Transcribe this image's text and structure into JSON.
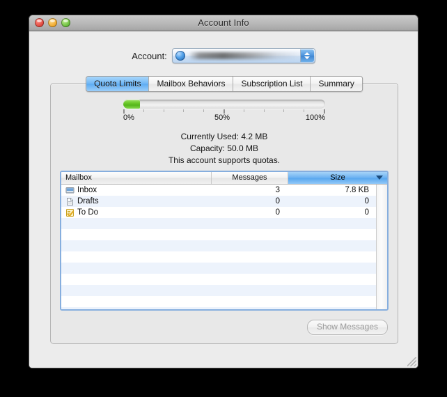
{
  "window": {
    "title": "Account Info",
    "traffic_lights": [
      "close-button",
      "minimize-button",
      "zoom-button"
    ]
  },
  "account": {
    "label": "Account:",
    "selected_value": "",
    "icon": "globe-icon",
    "redacted": true
  },
  "tabs": [
    {
      "label": "Quota Limits",
      "selected": true
    },
    {
      "label": "Mailbox Behaviors",
      "selected": false
    },
    {
      "label": "Subscription List",
      "selected": false
    },
    {
      "label": "Summary",
      "selected": false
    }
  ],
  "quota": {
    "percent_used": 8.4,
    "fill_color": "#6fcb2d",
    "axis_labels": [
      {
        "text": "0%",
        "pos": 0
      },
      {
        "text": "50%",
        "pos": 50
      },
      {
        "text": "100%",
        "pos": 100
      }
    ],
    "stats": [
      {
        "key": "Currently Used:",
        "value": "4.2 MB"
      },
      {
        "key": "Capacity:",
        "value": "50.0 MB"
      }
    ],
    "note": "This account supports quotas."
  },
  "table": {
    "columns": [
      {
        "label": "Mailbox",
        "sorted": false,
        "sort_dir": ""
      },
      {
        "label": "Messages",
        "sorted": false,
        "sort_dir": ""
      },
      {
        "label": "Size",
        "sorted": true,
        "sort_dir": "descending"
      }
    ],
    "rows": [
      {
        "icon": "inbox-icon",
        "mailbox": "Inbox",
        "messages": "3",
        "size": "7.8 KB"
      },
      {
        "icon": "drafts-icon",
        "mailbox": "Drafts",
        "messages": "0",
        "size": "0"
      },
      {
        "icon": "todo-icon",
        "mailbox": "To Do",
        "messages": "0",
        "size": "0"
      }
    ],
    "empty_row_count": 13
  },
  "footer": {
    "show_messages_label": "Show Messages",
    "show_messages_enabled": false
  }
}
